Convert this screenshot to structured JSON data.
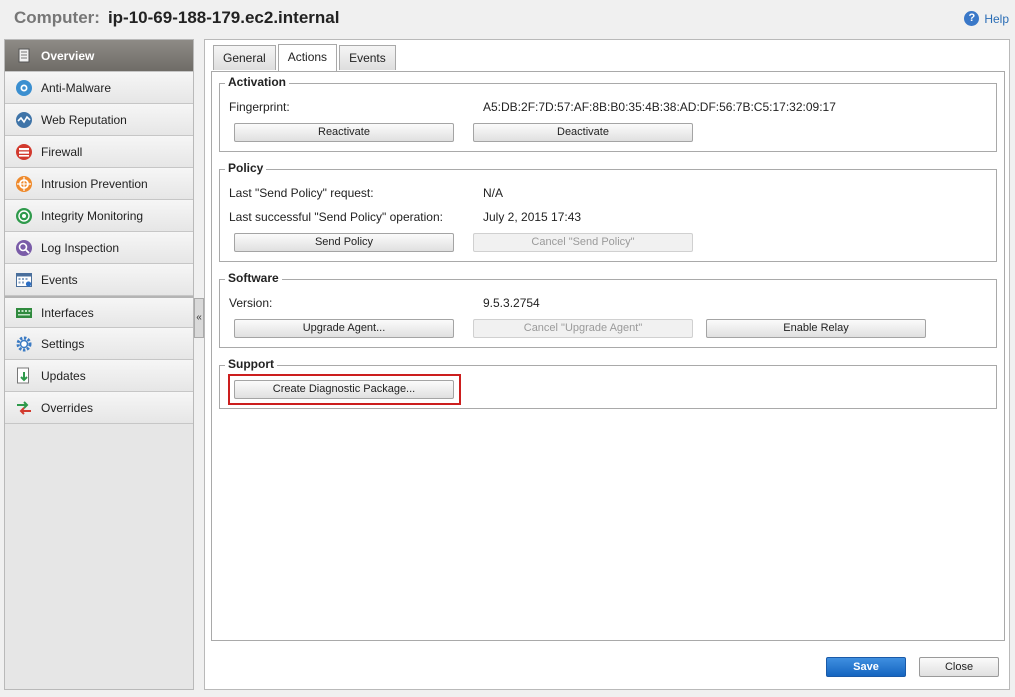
{
  "header": {
    "label": "Computer:",
    "hostname": "ip-10-69-188-179.ec2.internal",
    "help_label": "Help"
  },
  "sidebar": {
    "items": [
      {
        "label": "Overview",
        "icon": "overview-icon"
      },
      {
        "label": "Anti-Malware",
        "icon": "anti-malware-icon"
      },
      {
        "label": "Web Reputation",
        "icon": "web-reputation-icon"
      },
      {
        "label": "Firewall",
        "icon": "firewall-icon"
      },
      {
        "label": "Intrusion Prevention",
        "icon": "intrusion-prevention-icon"
      },
      {
        "label": "Integrity Monitoring",
        "icon": "integrity-monitoring-icon"
      },
      {
        "label": "Log Inspection",
        "icon": "log-inspection-icon"
      },
      {
        "label": "Events",
        "icon": "events-icon"
      },
      {
        "label": "Interfaces",
        "icon": "interfaces-icon"
      },
      {
        "label": "Settings",
        "icon": "settings-icon"
      },
      {
        "label": "Updates",
        "icon": "updates-icon"
      },
      {
        "label": "Overrides",
        "icon": "overrides-icon"
      }
    ],
    "collapse_label": "«"
  },
  "tabs": [
    {
      "label": "General"
    },
    {
      "label": "Actions"
    },
    {
      "label": "Events"
    }
  ],
  "activation": {
    "title": "Activation",
    "fingerprint_label": "Fingerprint:",
    "fingerprint_value": "A5:DB:2F:7D:57:AF:8B:B0:35:4B:38:AD:DF:56:7B:C5:17:32:09:17",
    "reactivate_label": "Reactivate",
    "deactivate_label": "Deactivate"
  },
  "policy": {
    "title": "Policy",
    "last_request_label": "Last \"Send Policy\" request:",
    "last_request_value": "N/A",
    "last_success_label": "Last successful \"Send Policy\" operation:",
    "last_success_value": "July 2, 2015 17:43",
    "send_label": "Send Policy",
    "cancel_label": "Cancel \"Send Policy\""
  },
  "software": {
    "title": "Software",
    "version_label": "Version:",
    "version_value": "9.5.3.2754",
    "upgrade_label": "Upgrade Agent...",
    "cancel_upgrade_label": "Cancel \"Upgrade Agent\"",
    "enable_relay_label": "Enable Relay"
  },
  "support": {
    "title": "Support",
    "create_label": "Create Diagnostic Package..."
  },
  "footer": {
    "save_label": "Save",
    "close_label": "Close"
  },
  "colors": {
    "accent": "#1565c0",
    "highlight": "#cc1e1e",
    "active_nav": "#7d7a75"
  }
}
